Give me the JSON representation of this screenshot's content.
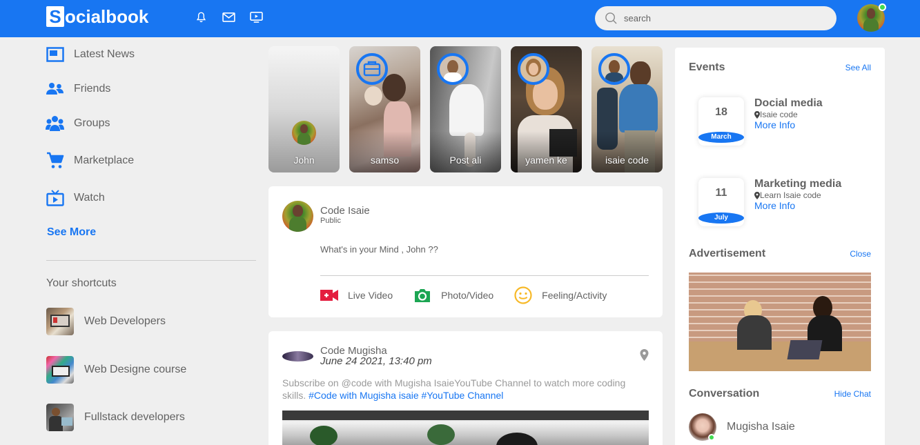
{
  "navbar": {
    "logo_initial": "S",
    "logo_text": "ocialbook",
    "search_placeholder": "search",
    "icons": [
      "bell-icon",
      "mail-icon",
      "video-icon"
    ],
    "brand_color": "#1876f2"
  },
  "sidebar": {
    "links": [
      {
        "label": "Latest News",
        "icon": "news-icon"
      },
      {
        "label": "Friends",
        "icon": "friends-icon"
      },
      {
        "label": "Groups",
        "icon": "groups-icon"
      },
      {
        "label": "Marketplace",
        "icon": "cart-icon"
      },
      {
        "label": "Watch",
        "icon": "watch-icon"
      }
    ],
    "see_more": "See More",
    "shortcuts_title": "Your shortcuts",
    "shortcuts": [
      {
        "label": "Web Developers"
      },
      {
        "label": "Web Designe course"
      },
      {
        "label": "Fullstack developers"
      }
    ]
  },
  "stories": [
    {
      "name": "John"
    },
    {
      "name": "samso"
    },
    {
      "name": "Post ali"
    },
    {
      "name": "yamen ke"
    },
    {
      "name": "isaie code"
    }
  ],
  "write_post": {
    "user_name": "Code Isaie",
    "privacy": "Public",
    "placeholder": "What's in your Mind , John ??",
    "actions": [
      {
        "label": "Live Video",
        "icon": "live-video-icon",
        "color": "#e41e3f"
      },
      {
        "label": "Photo/Video",
        "icon": "camera-icon",
        "color": "#1ca653"
      },
      {
        "label": "Feeling/Activity",
        "icon": "smiley-icon",
        "color": "#f7b928"
      }
    ]
  },
  "post": {
    "user_name": "Code Mugisha",
    "date": "June 24 2021, 13:40 pm",
    "text": "Subscribe on @code with Mugisha IsaieYouTube Channel to watch more coding skills.",
    "hashtags": "#Code with Mugisha isaie #YouTube Channel"
  },
  "right": {
    "events_title": "Events",
    "see_all": "See All",
    "events": [
      {
        "day": "18",
        "month": "March",
        "title": "Docial media",
        "location": "Isaie code",
        "more": "More Info"
      },
      {
        "day": "11",
        "month": "July",
        "title": "Marketing media",
        "location": "Learn Isaie code",
        "more": "More Info"
      }
    ],
    "ad_title": "Advertisement",
    "ad_close": "Close",
    "conversation_title": "Conversation",
    "hide_chat": "Hide Chat",
    "chats": [
      {
        "name": "Mugisha Isaie",
        "online": true
      }
    ]
  }
}
